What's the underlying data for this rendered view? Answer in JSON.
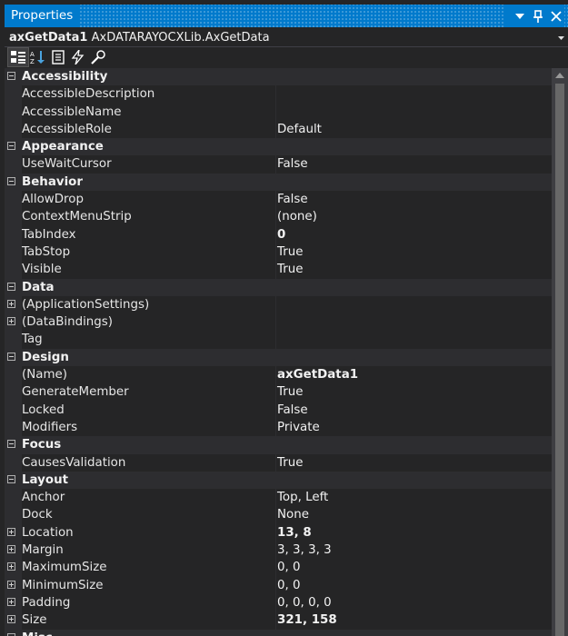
{
  "window": {
    "title": "Properties"
  },
  "object_selector": {
    "name": "axGetData1",
    "type": "AxDATARAYOCXLib.AxGetData"
  },
  "toolbar": {
    "icons": [
      "categorized-icon",
      "alphabetical-icon",
      "properties-icon",
      "events-icon",
      "property-pages-icon"
    ]
  },
  "scroll": {
    "position_fraction": 0.0
  },
  "rows": [
    {
      "kind": "cat",
      "name": "Accessibility",
      "expander": "minus"
    },
    {
      "kind": "prop",
      "name": "AccessibleDescription",
      "value": ""
    },
    {
      "kind": "prop",
      "name": "AccessibleName",
      "value": ""
    },
    {
      "kind": "prop",
      "name": "AccessibleRole",
      "value": "Default"
    },
    {
      "kind": "cat",
      "name": "Appearance",
      "expander": "minus"
    },
    {
      "kind": "prop",
      "name": "UseWaitCursor",
      "value": "False"
    },
    {
      "kind": "cat",
      "name": "Behavior",
      "expander": "minus"
    },
    {
      "kind": "prop",
      "name": "AllowDrop",
      "value": "False"
    },
    {
      "kind": "prop",
      "name": "ContextMenuStrip",
      "value": "(none)"
    },
    {
      "kind": "prop",
      "name": "TabIndex",
      "value": "0",
      "bold": true
    },
    {
      "kind": "prop",
      "name": "TabStop",
      "value": "True"
    },
    {
      "kind": "prop",
      "name": "Visible",
      "value": "True"
    },
    {
      "kind": "cat",
      "name": "Data",
      "expander": "minus"
    },
    {
      "kind": "prop",
      "name": "(ApplicationSettings)",
      "value": "",
      "expander": "plus"
    },
    {
      "kind": "prop",
      "name": "(DataBindings)",
      "value": "",
      "expander": "plus"
    },
    {
      "kind": "prop",
      "name": "Tag",
      "value": ""
    },
    {
      "kind": "cat",
      "name": "Design",
      "expander": "minus"
    },
    {
      "kind": "prop",
      "name": "(Name)",
      "value": "axGetData1",
      "bold": true
    },
    {
      "kind": "prop",
      "name": "GenerateMember",
      "value": "True"
    },
    {
      "kind": "prop",
      "name": "Locked",
      "value": "False"
    },
    {
      "kind": "prop",
      "name": "Modifiers",
      "value": "Private"
    },
    {
      "kind": "cat",
      "name": "Focus",
      "expander": "minus"
    },
    {
      "kind": "prop",
      "name": "CausesValidation",
      "value": "True"
    },
    {
      "kind": "cat",
      "name": "Layout",
      "expander": "minus"
    },
    {
      "kind": "prop",
      "name": "Anchor",
      "value": "Top, Left"
    },
    {
      "kind": "prop",
      "name": "Dock",
      "value": "None"
    },
    {
      "kind": "prop",
      "name": "Location",
      "value": "13, 8",
      "bold": true,
      "expander": "plus"
    },
    {
      "kind": "prop",
      "name": "Margin",
      "value": "3, 3, 3, 3",
      "expander": "plus"
    },
    {
      "kind": "prop",
      "name": "MaximumSize",
      "value": "0, 0",
      "expander": "plus"
    },
    {
      "kind": "prop",
      "name": "MinimumSize",
      "value": "0, 0",
      "expander": "plus"
    },
    {
      "kind": "prop",
      "name": "Padding",
      "value": "0, 0, 0, 0",
      "expander": "plus"
    },
    {
      "kind": "prop",
      "name": "Size",
      "value": "321, 158",
      "bold": true,
      "expander": "plus"
    },
    {
      "kind": "cat",
      "name": "Misc",
      "expander": "minus"
    }
  ]
}
